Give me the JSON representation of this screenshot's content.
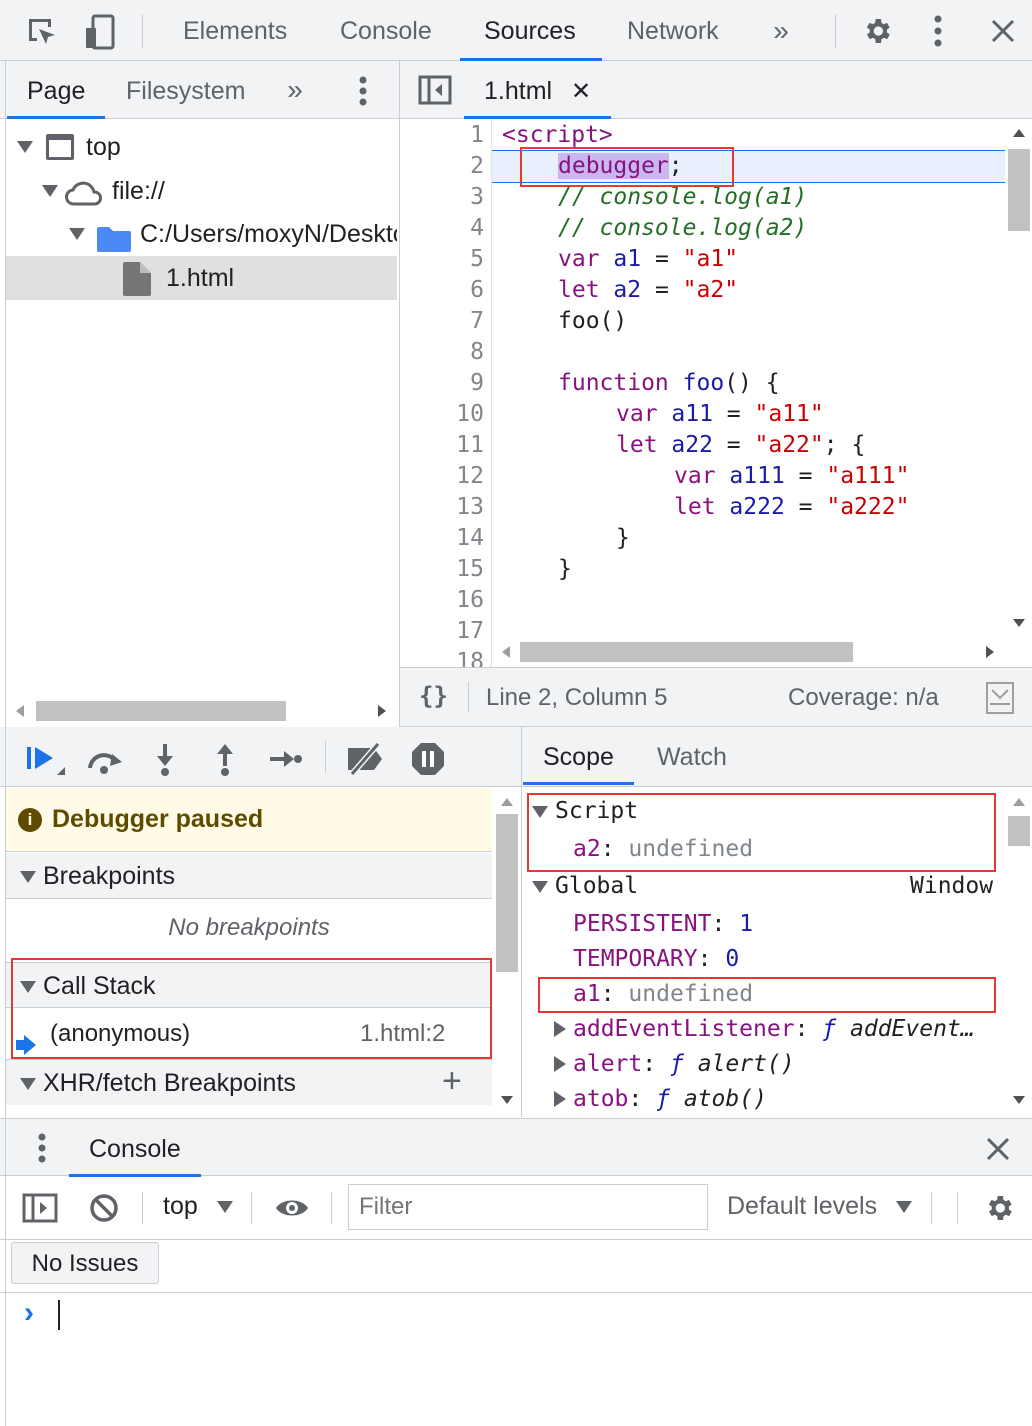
{
  "toolbar": {
    "tabs": [
      "Elements",
      "Console",
      "Sources",
      "Network"
    ],
    "active_tab": "Sources",
    "more_icon": "chevron-double-right-icon",
    "settings_icon": "gear-icon",
    "menu_icon": "kebab-menu-icon",
    "close_icon": "close-icon"
  },
  "navigator": {
    "tabs": [
      "Page",
      "Filesystem"
    ],
    "active_tab": "Page",
    "tree": [
      {
        "label": "top",
        "icon": "frame-icon"
      },
      {
        "label": "file://",
        "icon": "cloud-icon"
      },
      {
        "label": "C:/Users/moxyN/Desktop",
        "icon": "folder-icon"
      },
      {
        "label": "1.html",
        "icon": "file-icon",
        "selected": true
      }
    ]
  },
  "editor": {
    "file_tab": "1.html",
    "lines": [
      {
        "n": "1"
      },
      {
        "n": "2"
      },
      {
        "n": "3"
      },
      {
        "n": "4"
      },
      {
        "n": "5"
      },
      {
        "n": "6"
      },
      {
        "n": "7"
      },
      {
        "n": "8"
      },
      {
        "n": "9"
      },
      {
        "n": "10"
      },
      {
        "n": "11"
      },
      {
        "n": "12"
      },
      {
        "n": "13"
      },
      {
        "n": "14"
      },
      {
        "n": "15"
      },
      {
        "n": "16"
      },
      {
        "n": "17"
      },
      {
        "n": "18"
      }
    ],
    "code": {
      "l1": "<script>",
      "l2": "debugger",
      "l2b": ";",
      "l3": "// console.log(a1)",
      "l4": "// console.log(a2)",
      "l5a": "var",
      "l5b": "a1",
      "l5c": " = ",
      "l5d": "\"a1\"",
      "l6a": "let",
      "l6b": "a2",
      "l6c": " = ",
      "l6d": "\"a2\"",
      "l7": "foo()",
      "l9a": "function",
      "l9b": "foo",
      "l9c": "() {",
      "l10a": "var",
      "l10b": "a11",
      "l10c": " = ",
      "l10d": "\"a11\"",
      "l11a": "let",
      "l11b": "a22",
      "l11c": " = ",
      "l11d": "\"a22\"",
      "l11e": "; {",
      "l12a": "var",
      "l12b": "a111",
      "l12c": " = ",
      "l12d": "\"a111\"",
      "l13a": "let",
      "l13b": "a222",
      "l13c": " = ",
      "l13d": "\"a222\"",
      "l14": "}",
      "l15": "}"
    },
    "status_position": "Line 2, Column 5",
    "status_coverage": "Coverage: n/a",
    "format_icon": "{}"
  },
  "debugger": {
    "paused_text": "Debugger paused",
    "breakpoints_title": "Breakpoints",
    "no_breakpoints": "No breakpoints",
    "call_stack_title": "Call Stack",
    "frame_name": "(anonymous)",
    "frame_location": "1.html:2",
    "xhr_title": "XHR/fetch Breakpoints",
    "add_icon": "+"
  },
  "scope": {
    "tabs": [
      "Scope",
      "Watch"
    ],
    "active_tab": "Scope",
    "script_label": "Script",
    "script_var_name": "a2",
    "script_var_value": "undefined",
    "global_label": "Global",
    "global_value": "Window",
    "persistent_name": "PERSISTENT",
    "persistent_value": "1",
    "temporary_name": "TEMPORARY",
    "temporary_value": "0",
    "a1_name": "a1",
    "a1_value": "undefined",
    "add_listener_name": "addEventListener",
    "add_listener_value": "addEvent…",
    "alert_name": "alert",
    "alert_value": "alert()",
    "atob_name": "atob",
    "atob_value": "atob()",
    "func_glyph": "ƒ",
    "colon": ":"
  },
  "console": {
    "tab": "Console",
    "context": "top",
    "filter_placeholder": "Filter",
    "levels": "Default levels",
    "issues": "No Issues",
    "prompt": "›"
  }
}
